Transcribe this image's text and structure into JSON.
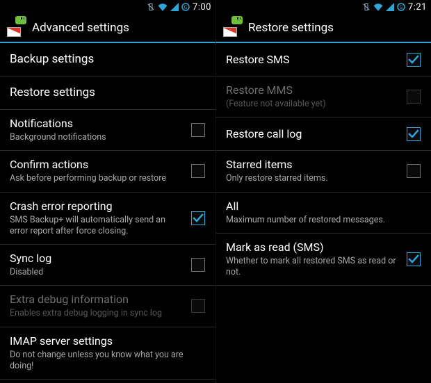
{
  "left": {
    "status": {
      "time": "7:00"
    },
    "title": "Advanced settings",
    "items": [
      {
        "primary": "Backup settings",
        "secondary": null,
        "checkbox": null,
        "disabled": false
      },
      {
        "primary": "Restore settings",
        "secondary": null,
        "checkbox": null,
        "disabled": false
      },
      {
        "primary": "Notifications",
        "secondary": "Background notifications",
        "checkbox": false,
        "disabled": false
      },
      {
        "primary": "Confirm actions",
        "secondary": "Ask before performing backup or restore",
        "checkbox": false,
        "disabled": false
      },
      {
        "primary": "Crash error reporting",
        "secondary": "SMS Backup+ will automatically send an error report after force closing.",
        "checkbox": true,
        "disabled": false
      },
      {
        "primary": "Sync log",
        "secondary": "Disabled",
        "checkbox": false,
        "disabled": false
      },
      {
        "primary": "Extra debug information",
        "secondary": "Enables extra debug logging in sync log",
        "checkbox": false,
        "disabled": true
      },
      {
        "primary": "IMAP server settings",
        "secondary": "Do not change unless you know what you are doing!",
        "checkbox": null,
        "disabled": false
      }
    ]
  },
  "right": {
    "status": {
      "time": "7:21"
    },
    "title": "Restore settings",
    "items": [
      {
        "primary": "Restore SMS",
        "secondary": null,
        "checkbox": true,
        "disabled": false
      },
      {
        "primary": "Restore MMS",
        "secondary": "(Feature not available yet)",
        "checkbox": false,
        "disabled": true
      },
      {
        "primary": "Restore call log",
        "secondary": null,
        "checkbox": true,
        "disabled": false
      },
      {
        "primary": "Starred items",
        "secondary": "Only restore starred items.",
        "checkbox": false,
        "disabled": false
      },
      {
        "primary": "All",
        "secondary": "Maximum number of restored messages.",
        "checkbox": null,
        "disabled": false
      },
      {
        "primary": "Mark as read (SMS)",
        "secondary": "Whether to mark all restored SMS as read or not.",
        "checkbox": true,
        "disabled": false
      }
    ]
  }
}
